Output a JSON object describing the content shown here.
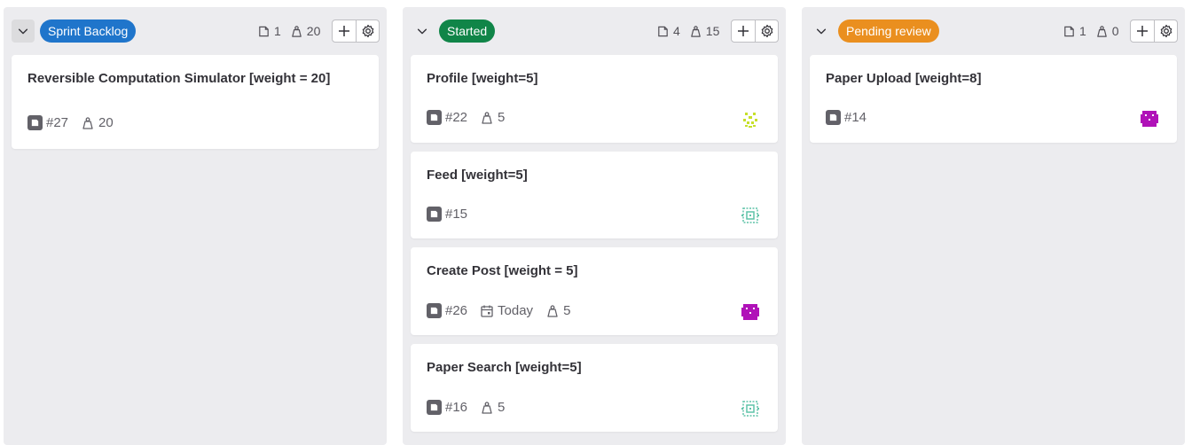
{
  "columns": [
    {
      "title": "Sprint Backlog",
      "color": "#1f75cb",
      "issue_count": "1",
      "weight_total": "20",
      "cards": [
        {
          "title": "Reversible Computation Simulator [weight = 20]",
          "id": "#27",
          "due": "",
          "weight": "20",
          "avatar": ""
        }
      ]
    },
    {
      "title": "Started",
      "color": "#108548",
      "issue_count": "4",
      "weight_total": "15",
      "cards": [
        {
          "title": "Profile [weight=5]",
          "id": "#22",
          "due": "",
          "weight": "5",
          "avatar": "yellow"
        },
        {
          "title": "Feed [weight=5]",
          "id": "#15",
          "due": "",
          "weight": "",
          "avatar": "teal"
        },
        {
          "title": "Create Post [weight = 5]",
          "id": "#26",
          "due": "Today",
          "weight": "5",
          "avatar": "magenta"
        },
        {
          "title": "Paper Search [weight=5]",
          "id": "#16",
          "due": "",
          "weight": "5",
          "avatar": "teal"
        }
      ]
    },
    {
      "title": "Pending review",
      "color": "#ea8f1f",
      "issue_count": "1",
      "weight_total": "0",
      "cards": [
        {
          "title": "Paper Upload [weight=8]",
          "id": "#14",
          "due": "",
          "weight": "",
          "avatar": "magenta"
        }
      ]
    }
  ],
  "icons": {
    "collapse": "chevron-down-icon",
    "issues": "issues-icon",
    "weight": "weight-icon",
    "add": "plus-icon",
    "settings": "gear-icon",
    "issue_type": "issue-type-icon",
    "due": "calendar-icon"
  },
  "avatar_colors": {
    "yellow": "#c6e02a",
    "teal": "#5fc3a8",
    "magenta": "#b012b8"
  }
}
